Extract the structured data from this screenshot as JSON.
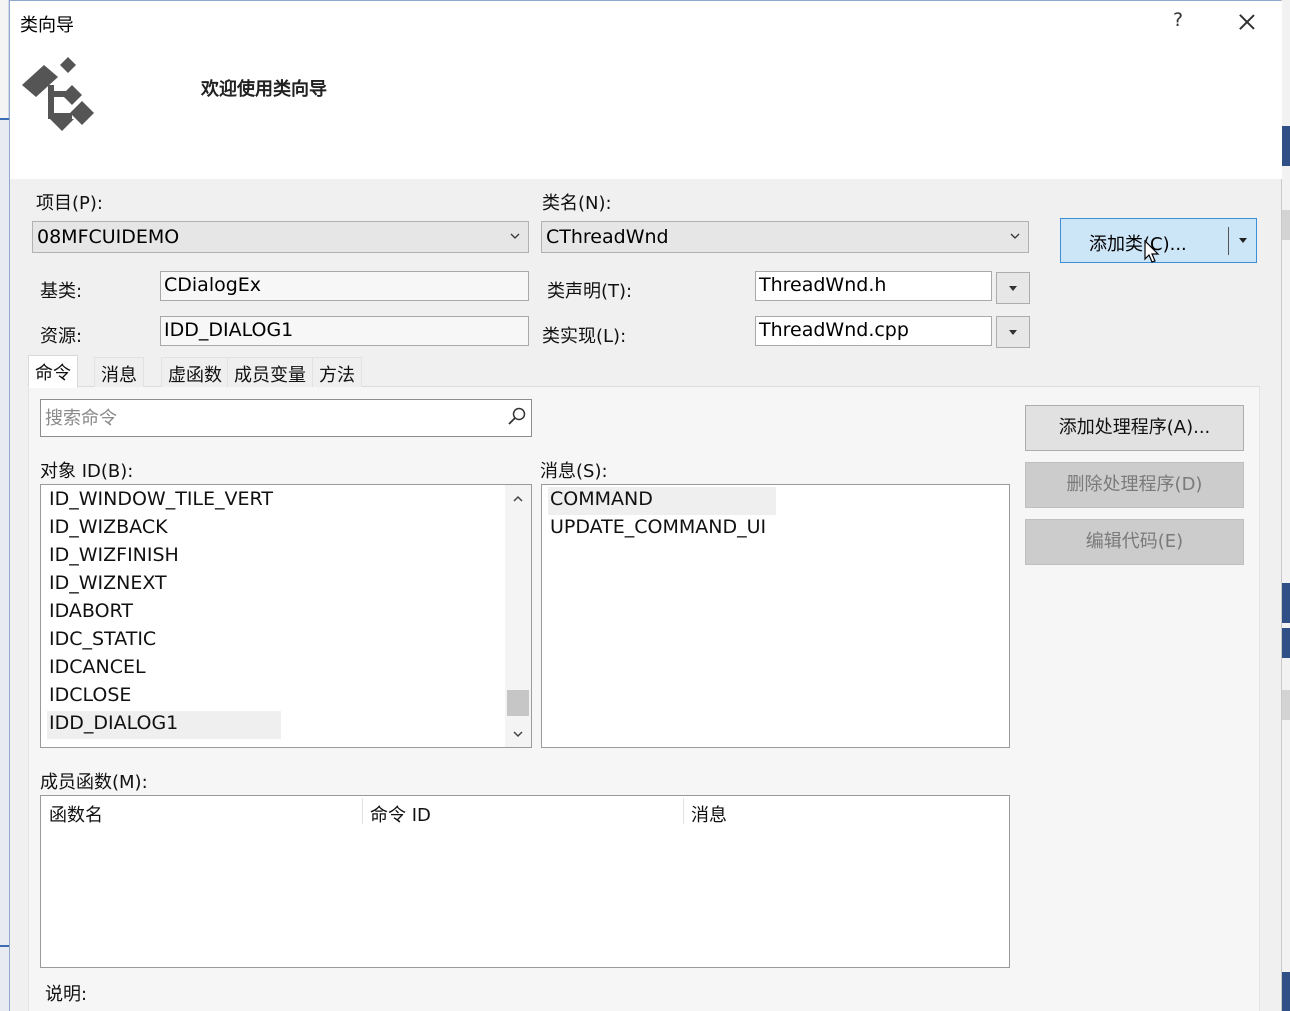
{
  "dialog": {
    "title": "类向导",
    "help_glyph": "?",
    "welcome": "欢迎使用类向导"
  },
  "form": {
    "project_label": "项目(P):",
    "project_value": "08MFCUIDEMO",
    "classname_label": "类名(N):",
    "classname_value": "CThreadWnd",
    "add_class_button": "添加类(C)...",
    "base_label": "基类:",
    "base_value": "CDialogEx",
    "resource_label": "资源:",
    "resource_value": "IDD_DIALOG1",
    "header_label": "类声明(T):",
    "header_value": "ThreadWnd.h",
    "impl_label": "类实现(L):",
    "impl_value": "ThreadWnd.cpp"
  },
  "tabs": [
    {
      "label": "命令",
      "active": true
    },
    {
      "label": "消息",
      "active": false
    },
    {
      "label": "虚函数",
      "active": false
    },
    {
      "label": "成员变量",
      "active": false
    },
    {
      "label": "方法",
      "active": false
    }
  ],
  "search": {
    "placeholder": "搜索命令",
    "value": ""
  },
  "buttons": {
    "add_handler": "添加处理程序(A)...",
    "delete_handler": "删除处理程序(D)",
    "edit_code": "编辑代码(E)"
  },
  "object_ids": {
    "label": "对象 ID(B):",
    "items": [
      "ID_WINDOW_TILE_VERT",
      "ID_WIZBACK",
      "ID_WIZFINISH",
      "ID_WIZNEXT",
      "IDABORT",
      "IDC_STATIC",
      "IDCANCEL",
      "IDCLOSE",
      "IDD_DIALOG1"
    ],
    "selected": "IDD_DIALOG1"
  },
  "messages": {
    "label": "消息(S):",
    "items": [
      "COMMAND",
      "UPDATE_COMMAND_UI"
    ],
    "selected": "COMMAND"
  },
  "member_functions": {
    "label": "成员函数(M):",
    "columns": [
      "函数名",
      "命令 ID",
      "消息"
    ],
    "rows": []
  },
  "description": {
    "label": "说明:"
  },
  "colors": {
    "accent": "#3c8fd7",
    "button_hover": "#cde6f7",
    "window_bg": "#f0f0f0"
  }
}
